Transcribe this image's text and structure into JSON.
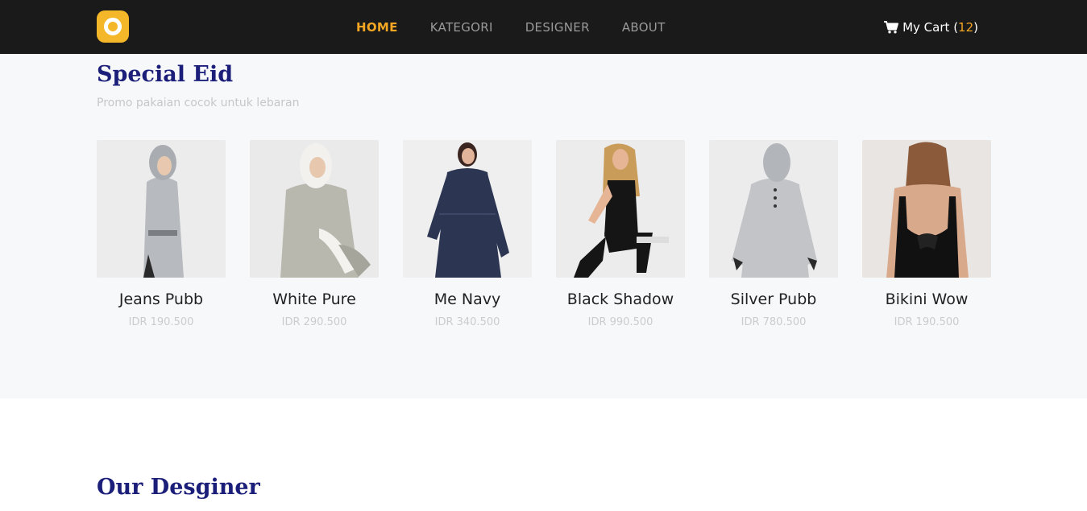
{
  "nav": {
    "logo_icon": "ring-logo-icon",
    "links": [
      {
        "label": "HOME",
        "active": true
      },
      {
        "label": "KATEGORI",
        "active": false
      },
      {
        "label": "DESIGNER",
        "active": false
      },
      {
        "label": "ABOUT",
        "active": false
      }
    ],
    "cart": {
      "icon": "cart-icon",
      "label": "My Cart",
      "open": "(",
      "count": "12",
      "close": ")"
    }
  },
  "special": {
    "title": "Special Eid",
    "subtitle": "Promo pakaian cocok untuk lebaran",
    "products": [
      {
        "name": "Jeans Pubb",
        "price": "IDR 190.500"
      },
      {
        "name": "White Pure",
        "price": "IDR 290.500"
      },
      {
        "name": "Me Navy",
        "price": "IDR 340.500"
      },
      {
        "name": "Black Shadow",
        "price": "IDR 990.500"
      },
      {
        "name": "Silver Pubb",
        "price": "IDR 780.500"
      },
      {
        "name": "Bikini Wow",
        "price": "IDR 190.500"
      }
    ]
  },
  "designer": {
    "title": "Our Desginer"
  },
  "colors": {
    "nav_bg": "#1a1a1a",
    "accent": "#f5a623",
    "title": "#1c1f7a",
    "section_bg": "#f7f8fa"
  }
}
